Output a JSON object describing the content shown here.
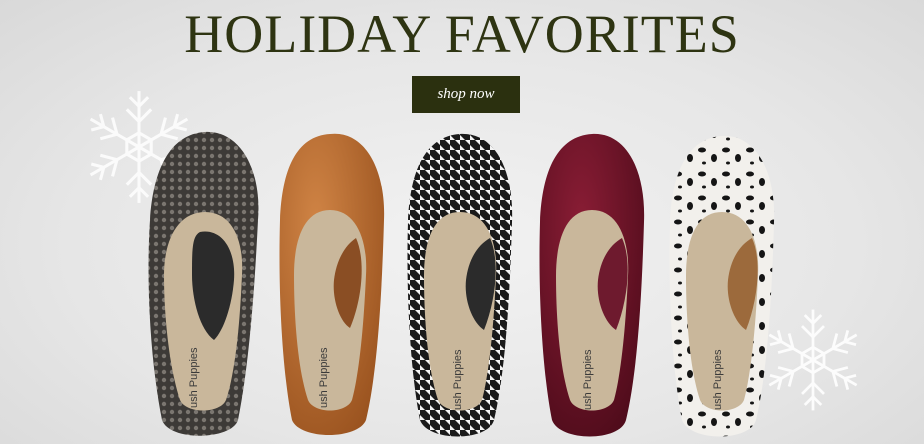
{
  "banner": {
    "title": "HOLIDAY FAVORITES",
    "cta_label": "shop now"
  },
  "shoes": [
    {
      "name": "Black lace-print ballet flat",
      "color": "#3f3b38",
      "brand_mark": "ush Puppies"
    },
    {
      "name": "Tan leather ballet flat",
      "color": "#b5652a",
      "brand_mark": "ush Puppies"
    },
    {
      "name": "Houndstooth ballet flat",
      "color": "#2a2a2a",
      "brand_mark": "ush Puppies"
    },
    {
      "name": "Burgundy velvet ballet flat",
      "color": "#6b1226",
      "brand_mark": "ush Puppies"
    },
    {
      "name": "White leopard-print ballet flat",
      "color": "#f1efea",
      "brand_mark": "ush Puppies"
    }
  ],
  "colors": {
    "title": "#2e3412",
    "button_bg": "#2b300f",
    "button_text": "#ffffff"
  }
}
